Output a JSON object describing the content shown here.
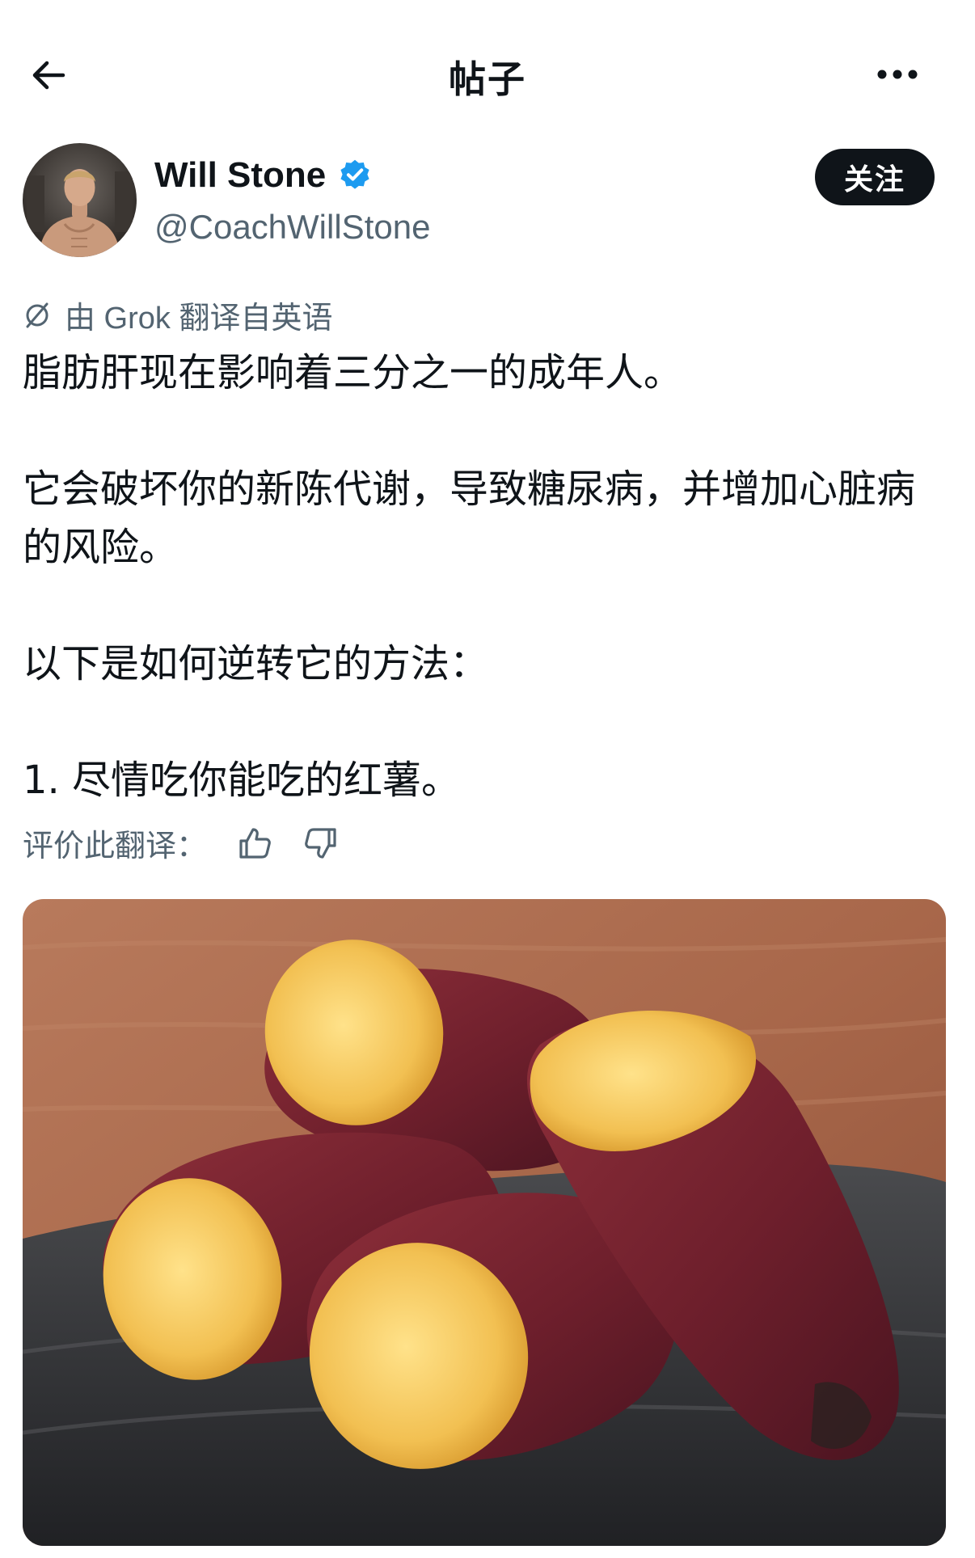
{
  "header": {
    "title": "帖子",
    "back_icon": "arrow-left-icon",
    "more_icon": "more-horizontal-icon"
  },
  "author": {
    "display_name": "Will Stone",
    "handle": "@CoachWillStone",
    "verified": true,
    "follow_label": "关注"
  },
  "translation_note": {
    "text": "由 Grok 翻译自英语",
    "icon": "grok-icon"
  },
  "post": {
    "paragraphs": [
      "脂肪肝现在影响着三分之一的成年人。",
      "它会破坏你的新陈代谢，导致糖尿病，并增加心脏病的风险。",
      "以下是如何逆转它的方法：",
      "1. 尽情吃你能吃的红薯。"
    ]
  },
  "rate_translation": {
    "label": "评价此翻译：",
    "up_icon": "thumbs-up-icon",
    "down_icon": "thumbs-down-icon"
  },
  "colors": {
    "text": "#0f1419",
    "secondary": "#536471",
    "verified": "#1d9bf0",
    "button_bg": "#0f1419"
  }
}
